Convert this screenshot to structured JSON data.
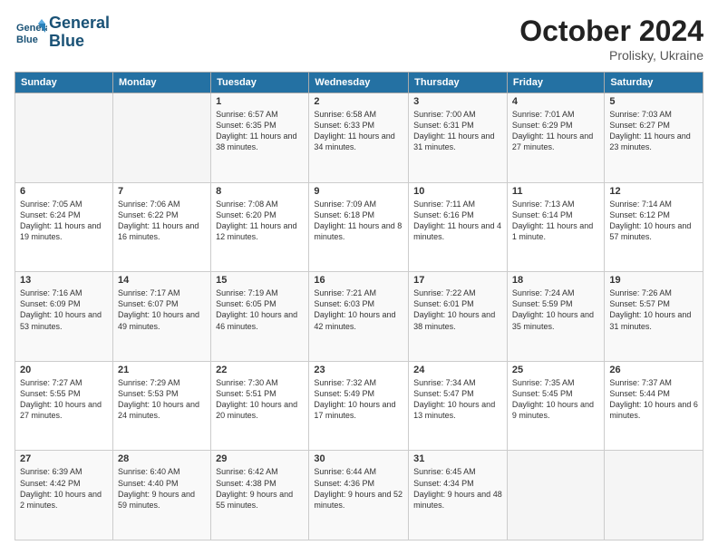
{
  "logo": {
    "line1": "General",
    "line2": "Blue"
  },
  "title": "October 2024",
  "subtitle": "Prolisky, Ukraine",
  "days_of_week": [
    "Sunday",
    "Monday",
    "Tuesday",
    "Wednesday",
    "Thursday",
    "Friday",
    "Saturday"
  ],
  "weeks": [
    [
      {
        "day": "",
        "info": ""
      },
      {
        "day": "",
        "info": ""
      },
      {
        "day": "1",
        "info": "Sunrise: 6:57 AM\nSunset: 6:35 PM\nDaylight: 11 hours and 38 minutes."
      },
      {
        "day": "2",
        "info": "Sunrise: 6:58 AM\nSunset: 6:33 PM\nDaylight: 11 hours and 34 minutes."
      },
      {
        "day": "3",
        "info": "Sunrise: 7:00 AM\nSunset: 6:31 PM\nDaylight: 11 hours and 31 minutes."
      },
      {
        "day": "4",
        "info": "Sunrise: 7:01 AM\nSunset: 6:29 PM\nDaylight: 11 hours and 27 minutes."
      },
      {
        "day": "5",
        "info": "Sunrise: 7:03 AM\nSunset: 6:27 PM\nDaylight: 11 hours and 23 minutes."
      }
    ],
    [
      {
        "day": "6",
        "info": "Sunrise: 7:05 AM\nSunset: 6:24 PM\nDaylight: 11 hours and 19 minutes."
      },
      {
        "day": "7",
        "info": "Sunrise: 7:06 AM\nSunset: 6:22 PM\nDaylight: 11 hours and 16 minutes."
      },
      {
        "day": "8",
        "info": "Sunrise: 7:08 AM\nSunset: 6:20 PM\nDaylight: 11 hours and 12 minutes."
      },
      {
        "day": "9",
        "info": "Sunrise: 7:09 AM\nSunset: 6:18 PM\nDaylight: 11 hours and 8 minutes."
      },
      {
        "day": "10",
        "info": "Sunrise: 7:11 AM\nSunset: 6:16 PM\nDaylight: 11 hours and 4 minutes."
      },
      {
        "day": "11",
        "info": "Sunrise: 7:13 AM\nSunset: 6:14 PM\nDaylight: 11 hours and 1 minute."
      },
      {
        "day": "12",
        "info": "Sunrise: 7:14 AM\nSunset: 6:12 PM\nDaylight: 10 hours and 57 minutes."
      }
    ],
    [
      {
        "day": "13",
        "info": "Sunrise: 7:16 AM\nSunset: 6:09 PM\nDaylight: 10 hours and 53 minutes."
      },
      {
        "day": "14",
        "info": "Sunrise: 7:17 AM\nSunset: 6:07 PM\nDaylight: 10 hours and 49 minutes."
      },
      {
        "day": "15",
        "info": "Sunrise: 7:19 AM\nSunset: 6:05 PM\nDaylight: 10 hours and 46 minutes."
      },
      {
        "day": "16",
        "info": "Sunrise: 7:21 AM\nSunset: 6:03 PM\nDaylight: 10 hours and 42 minutes."
      },
      {
        "day": "17",
        "info": "Sunrise: 7:22 AM\nSunset: 6:01 PM\nDaylight: 10 hours and 38 minutes."
      },
      {
        "day": "18",
        "info": "Sunrise: 7:24 AM\nSunset: 5:59 PM\nDaylight: 10 hours and 35 minutes."
      },
      {
        "day": "19",
        "info": "Sunrise: 7:26 AM\nSunset: 5:57 PM\nDaylight: 10 hours and 31 minutes."
      }
    ],
    [
      {
        "day": "20",
        "info": "Sunrise: 7:27 AM\nSunset: 5:55 PM\nDaylight: 10 hours and 27 minutes."
      },
      {
        "day": "21",
        "info": "Sunrise: 7:29 AM\nSunset: 5:53 PM\nDaylight: 10 hours and 24 minutes."
      },
      {
        "day": "22",
        "info": "Sunrise: 7:30 AM\nSunset: 5:51 PM\nDaylight: 10 hours and 20 minutes."
      },
      {
        "day": "23",
        "info": "Sunrise: 7:32 AM\nSunset: 5:49 PM\nDaylight: 10 hours and 17 minutes."
      },
      {
        "day": "24",
        "info": "Sunrise: 7:34 AM\nSunset: 5:47 PM\nDaylight: 10 hours and 13 minutes."
      },
      {
        "day": "25",
        "info": "Sunrise: 7:35 AM\nSunset: 5:45 PM\nDaylight: 10 hours and 9 minutes."
      },
      {
        "day": "26",
        "info": "Sunrise: 7:37 AM\nSunset: 5:44 PM\nDaylight: 10 hours and 6 minutes."
      }
    ],
    [
      {
        "day": "27",
        "info": "Sunrise: 6:39 AM\nSunset: 4:42 PM\nDaylight: 10 hours and 2 minutes."
      },
      {
        "day": "28",
        "info": "Sunrise: 6:40 AM\nSunset: 4:40 PM\nDaylight: 9 hours and 59 minutes."
      },
      {
        "day": "29",
        "info": "Sunrise: 6:42 AM\nSunset: 4:38 PM\nDaylight: 9 hours and 55 minutes."
      },
      {
        "day": "30",
        "info": "Sunrise: 6:44 AM\nSunset: 4:36 PM\nDaylight: 9 hours and 52 minutes."
      },
      {
        "day": "31",
        "info": "Sunrise: 6:45 AM\nSunset: 4:34 PM\nDaylight: 9 hours and 48 minutes."
      },
      {
        "day": "",
        "info": ""
      },
      {
        "day": "",
        "info": ""
      }
    ]
  ]
}
